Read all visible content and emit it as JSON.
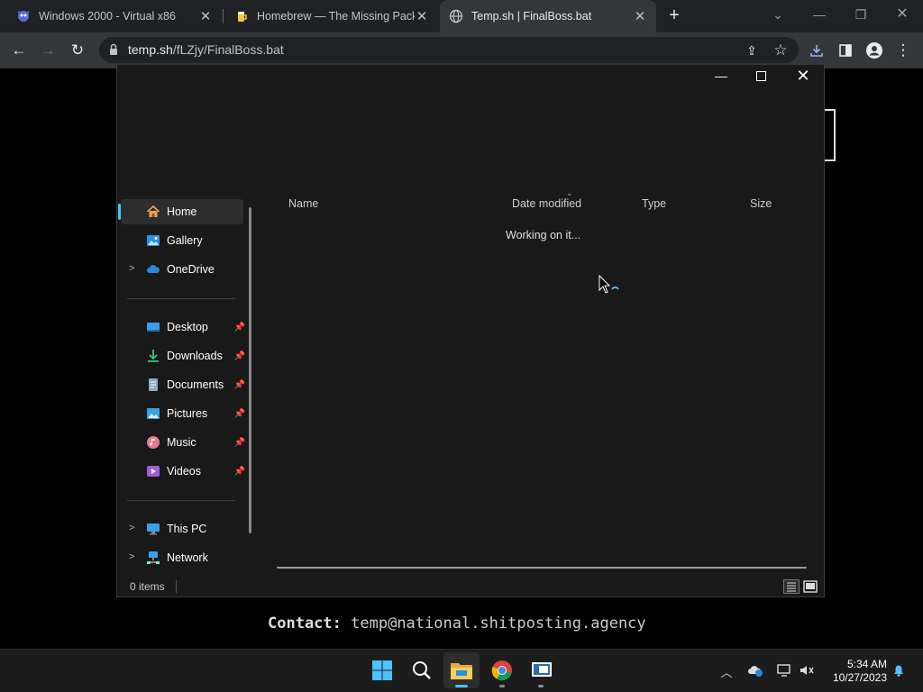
{
  "browser": {
    "tabs": [
      {
        "title": "Windows 2000 - Virtual x86",
        "favicon": "v86-logo-icon"
      },
      {
        "title": "Homebrew — The Missing Packa",
        "favicon": "beer-mug-icon"
      },
      {
        "title": "Temp.sh | FinalBoss.bat",
        "favicon": "globe-icon",
        "active": true
      }
    ],
    "url_host": "temp.sh",
    "url_path": "/fLZjy/FinalBoss.bat",
    "accent": "#35363a"
  },
  "page": {
    "contact_label": "Contact:",
    "contact_email": "temp@national.shitposting.agency"
  },
  "explorer": {
    "nav_items": {
      "home": "Home",
      "gallery": "Gallery",
      "onedrive": "OneDrive",
      "desktop": "Desktop",
      "downloads": "Downloads",
      "documents": "Documents",
      "pictures": "Pictures",
      "music": "Music",
      "videos": "Videos",
      "this_pc": "This PC",
      "network": "Network"
    },
    "columns": {
      "name": "Name",
      "date_modified": "Date modified",
      "type": "Type",
      "size": "Size"
    },
    "loading_text": "Working on it...",
    "status": "0 items",
    "accent": "#4cc2ff"
  },
  "taskbar": {
    "time": "5:34 AM",
    "date": "10/27/2023"
  }
}
